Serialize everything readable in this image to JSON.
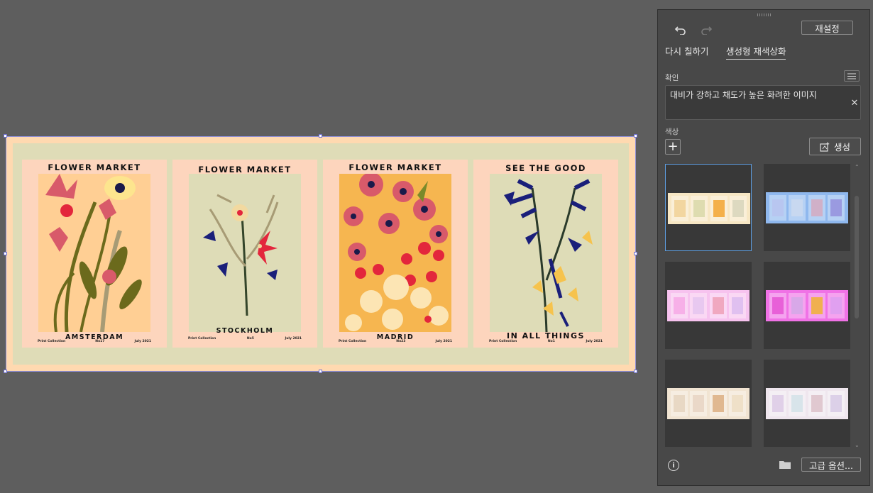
{
  "artboard": {
    "posters": [
      {
        "title": "FLOWER MARKET",
        "city": "AMSTERDAM",
        "foot_left": "Print Collection",
        "foot_mid": "No17",
        "foot_right": "July 2021"
      },
      {
        "title": "FLOWER MARKET",
        "city": "STOCKHOLM",
        "foot_left": "Print Collection",
        "foot_mid": "No5",
        "foot_right": "July 2021"
      },
      {
        "title": "FLOWER MARKET",
        "city": "MADRID",
        "foot_left": "Print Collection",
        "foot_mid": "No23",
        "foot_right": "July 2021"
      },
      {
        "title": "SEE THE GOOD",
        "city": "IN ALL THINGS",
        "foot_left": "Print Collection",
        "foot_mid": "No1",
        "foot_right": "July 2021"
      }
    ]
  },
  "panel": {
    "reset_label": "재설정",
    "tabs": [
      {
        "label": "다시 칠하기",
        "active": false
      },
      {
        "label": "생성형 재색상화",
        "active": true
      }
    ],
    "prompt_label": "확인",
    "prompt_text": "대비가 강하고 채도가 높은 화려한 이미지",
    "color_label": "색상",
    "generate_label": "생성",
    "advanced_label": "고급 옵션...",
    "variations": [
      {
        "bg": "#f7e7c4",
        "cards": [
          "#f2d6a0",
          "#dedcb0",
          "#f4b04a",
          "#ddd9c0"
        ],
        "selected": true
      },
      {
        "bg": "#8fb8ee",
        "cards": [
          "#b8c6f0",
          "#c8d8f0",
          "#d0b0c8",
          "#9a9ae0"
        ],
        "selected": false
      },
      {
        "bg": "#f7c3ef",
        "cards": [
          "#f7b0e8",
          "#e8c8f0",
          "#f0a8c0",
          "#e0c0f0"
        ],
        "selected": false
      },
      {
        "bg": "#f072e6",
        "cards": [
          "#e860d8",
          "#d8a8e8",
          "#f0b050",
          "#e0a0f0"
        ],
        "selected": false
      },
      {
        "bg": "#f1e4d2",
        "cards": [
          "#e8d8c4",
          "#ead8c8",
          "#e0b890",
          "#efe0c8"
        ],
        "selected": false
      },
      {
        "bg": "#efe6ee",
        "cards": [
          "#e0d0e8",
          "#d8e4ea",
          "#e0c8d0",
          "#dcd0e8"
        ],
        "selected": false
      }
    ]
  }
}
